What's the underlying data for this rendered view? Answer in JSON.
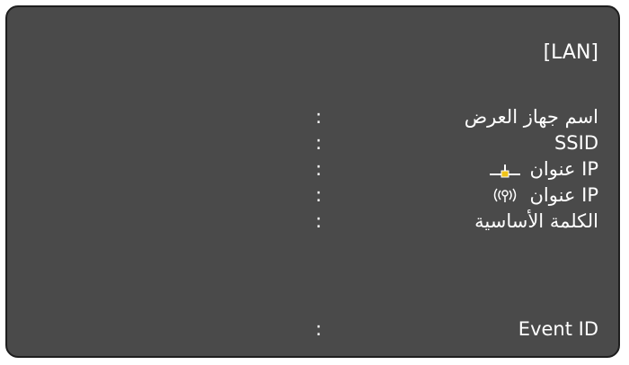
{
  "panel": {
    "title": "[LAN]",
    "rows": [
      {
        "label": "اسم جهاز العرض",
        "colon": ":"
      },
      {
        "label": "SSID",
        "colon": ":"
      },
      {
        "label": "عنوان IP",
        "icon": "wired-lan-icon",
        "colon": ":"
      },
      {
        "label": "عنوان IP",
        "icon": "wireless-lan-icon",
        "colon": ":"
      },
      {
        "label": "الكلمة الأساسية",
        "colon": ":"
      },
      {
        "label": "Event ID",
        "colon": ":"
      }
    ]
  }
}
